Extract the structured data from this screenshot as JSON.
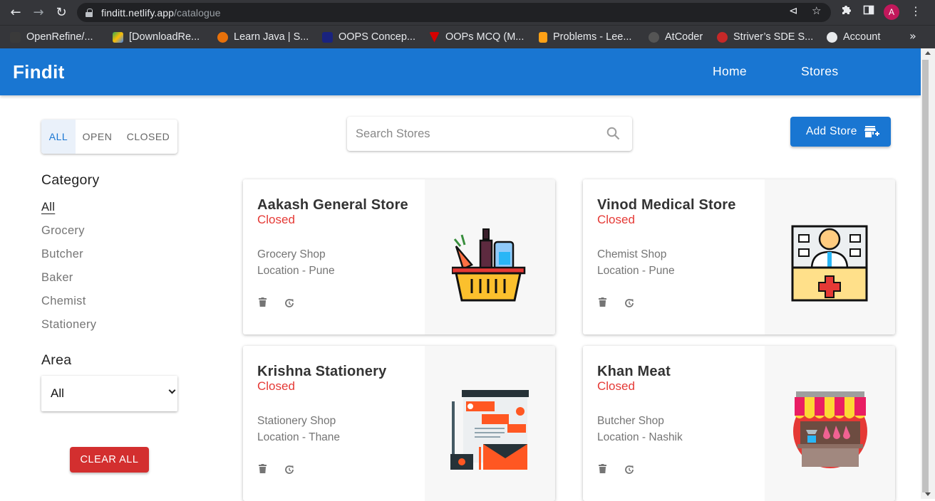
{
  "browser": {
    "url_host": "finditt.netlify.app",
    "url_path": "/catalogue",
    "avatar_letter": "A",
    "bookmarks": [
      {
        "label": "OpenRefine/...",
        "color": "#3a3a3a"
      },
      {
        "label": "[DownloadRe...",
        "color": "#34a853"
      },
      {
        "label": "Learn Java | S...",
        "color": "#e8710a"
      },
      {
        "label": "OOPS Concep...",
        "color": "#1a237e"
      },
      {
        "label": "OOPs MCQ (M...",
        "color": "#d50000"
      },
      {
        "label": "Problems - Lee...",
        "color": "#ffa116"
      },
      {
        "label": "AtCoder",
        "color": "#555555"
      },
      {
        "label": "Striver’s SDE S...",
        "color": "#c62828"
      },
      {
        "label": "Account",
        "color": "#e8eaed"
      }
    ]
  },
  "header": {
    "brand": "Findit",
    "nav": [
      "Home",
      "Stores"
    ],
    "color": "#1976d2"
  },
  "filters": {
    "status_tabs": [
      "ALL",
      "OPEN",
      "CLOSED"
    ],
    "active_tab": "ALL",
    "category_heading": "Category",
    "categories": [
      "All",
      "Grocery",
      "Butcher",
      "Baker",
      "Chemist",
      "Stationery"
    ],
    "selected_category": "All",
    "area_heading": "Area",
    "area_value": "All",
    "clear_label": "CLEAR ALL",
    "clear_color": "#d32f2f"
  },
  "search": {
    "placeholder": "Search Stores"
  },
  "add_store": {
    "label": "Add Store"
  },
  "stores": [
    {
      "name": "Aakash General Store",
      "status": "Closed",
      "type": "Grocery Shop",
      "location": "Location - Pune",
      "icon": "grocery-basket-icon"
    },
    {
      "name": "Vinod Medical Store",
      "status": "Closed",
      "type": "Chemist Shop",
      "location": "Location - Pune",
      "icon": "chemist-icon"
    },
    {
      "name": "Krishna Stationery",
      "status": "Closed",
      "type": "Stationery Shop",
      "location": "Location - Thane",
      "icon": "stationery-icon"
    },
    {
      "name": "Khan Meat",
      "status": "Closed",
      "type": "Butcher Shop",
      "location": "Location - Nashik",
      "icon": "butcher-shop-icon"
    }
  ],
  "status_color": "#e53935"
}
